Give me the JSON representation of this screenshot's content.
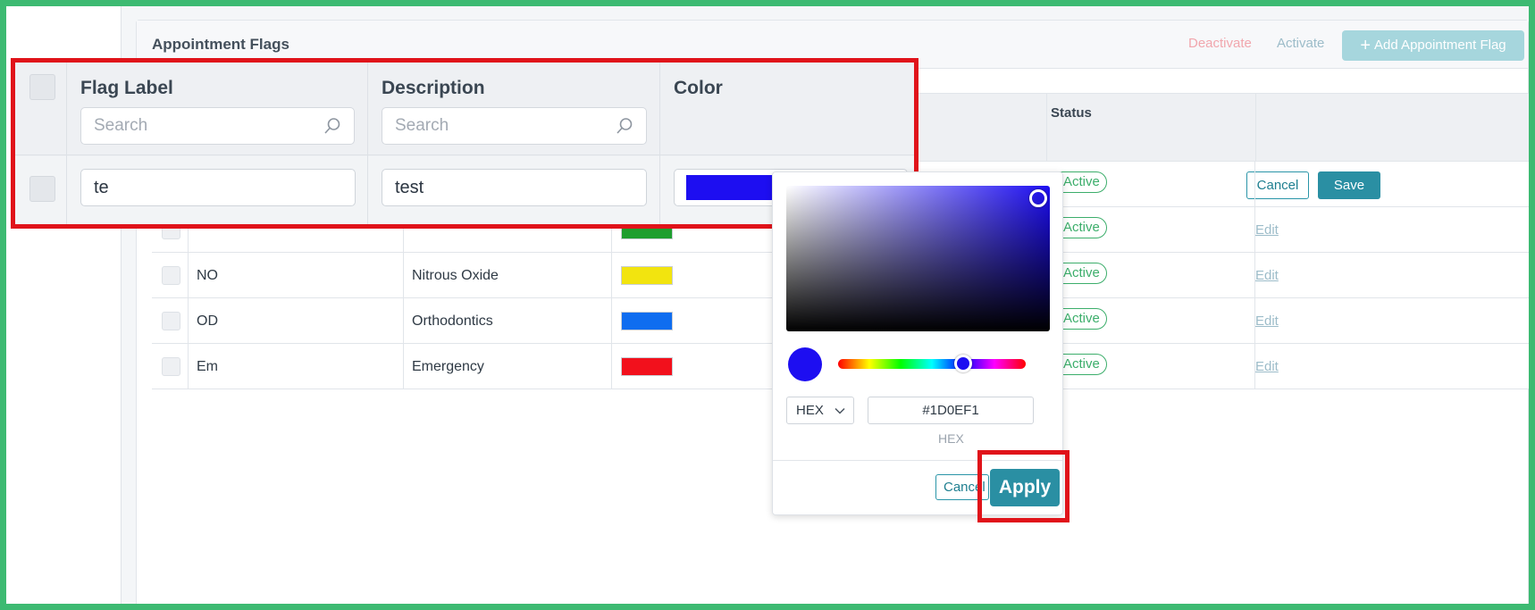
{
  "header": {
    "title": "Appointment Flags",
    "deactivate_label": "Deactivate",
    "activate_label": "Activate",
    "add_label": "Add Appointment Flag"
  },
  "table": {
    "status_header": "Status",
    "rows": [
      {
        "label": "",
        "description": "",
        "color": "",
        "status": "Active",
        "action": ""
      },
      {
        "label": "",
        "description": "",
        "color": "#1e9e2f",
        "status": "Active",
        "action": "Edit"
      },
      {
        "label": "NO",
        "description": "Nitrous Oxide",
        "color": "#f2e40f",
        "status": "Active",
        "action": "Edit"
      },
      {
        "label": "OD",
        "description": "Orthodontics",
        "color": "#0f6df0",
        "status": "Active",
        "action": "Edit"
      },
      {
        "label": "Em",
        "description": "Emergency",
        "color": "#f2101c",
        "status": "Active",
        "action": "Edit"
      }
    ],
    "row_cancel_label": "Cancel",
    "row_save_label": "Save"
  },
  "zoom": {
    "flag_label_header": "Flag Label",
    "description_header": "Description",
    "color_header": "Color",
    "search_placeholder": "Search",
    "edit_label_value": "te",
    "edit_description_value": "test",
    "edit_color": "#1D0EF1"
  },
  "picker": {
    "format": "HEX",
    "hex_value": "#1D0EF1",
    "hex_label": "HEX",
    "cancel_label": "Cancel",
    "apply_label": "Apply",
    "selected_color": "#1D0EF1"
  }
}
